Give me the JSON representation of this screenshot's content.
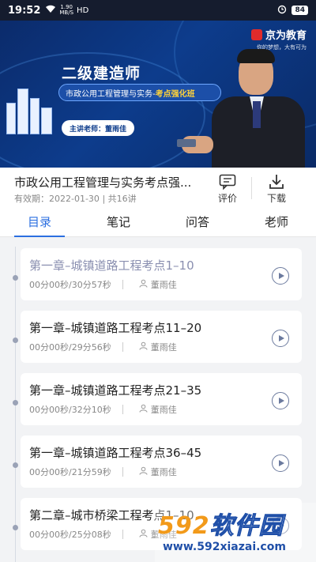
{
  "status_bar": {
    "time": "19:52",
    "network_speed": "1.90\nMB/S",
    "network_type": "HD",
    "battery": "84"
  },
  "banner": {
    "logo_name": "京为教育",
    "logo_slogan": "你的梦想，大有可为",
    "title": "二级建造师",
    "subtitle_main": "市政公用工程管理与实务-",
    "subtitle_highlight": "考点强化班",
    "teacher_badge": "主讲老师：董雨佳"
  },
  "course": {
    "title": "市政公用工程管理与实务考点强...",
    "validity": "有效期：2022-01-30",
    "lesson_count": "共16讲",
    "review_label": "评价",
    "download_label": "下载"
  },
  "tabs": [
    {
      "label": "目录",
      "active": true
    },
    {
      "label": "笔记",
      "active": false
    },
    {
      "label": "问答",
      "active": false
    },
    {
      "label": "老师",
      "active": false
    }
  ],
  "lessons": [
    {
      "title": "第一章–城镇道路工程考点1–10",
      "progress": "00分00秒/30分57秒",
      "teacher": "董雨佳",
      "active": true
    },
    {
      "title": "第一章–城镇道路工程考点11–20",
      "progress": "00分00秒/29分56秒",
      "teacher": "董雨佳",
      "active": false
    },
    {
      "title": "第一章–城镇道路工程考点21–35",
      "progress": "00分00秒/32分10秒",
      "teacher": "董雨佳",
      "active": false
    },
    {
      "title": "第一章–城镇道路工程考点36–45",
      "progress": "00分00秒/21分59秒",
      "teacher": "董雨佳",
      "active": false
    },
    {
      "title": "第二章–城市桥梁工程考点1–10",
      "progress": "00分00秒/25分08秒",
      "teacher": "董雨佳",
      "active": false
    }
  ],
  "watermark": {
    "number": "592",
    "name": "软件园",
    "url": "www.592xiazai.com"
  },
  "colors": {
    "accent": "#2b6fe0",
    "banner_bg": "#0d3c8c",
    "highlight": "#ffd23a"
  }
}
